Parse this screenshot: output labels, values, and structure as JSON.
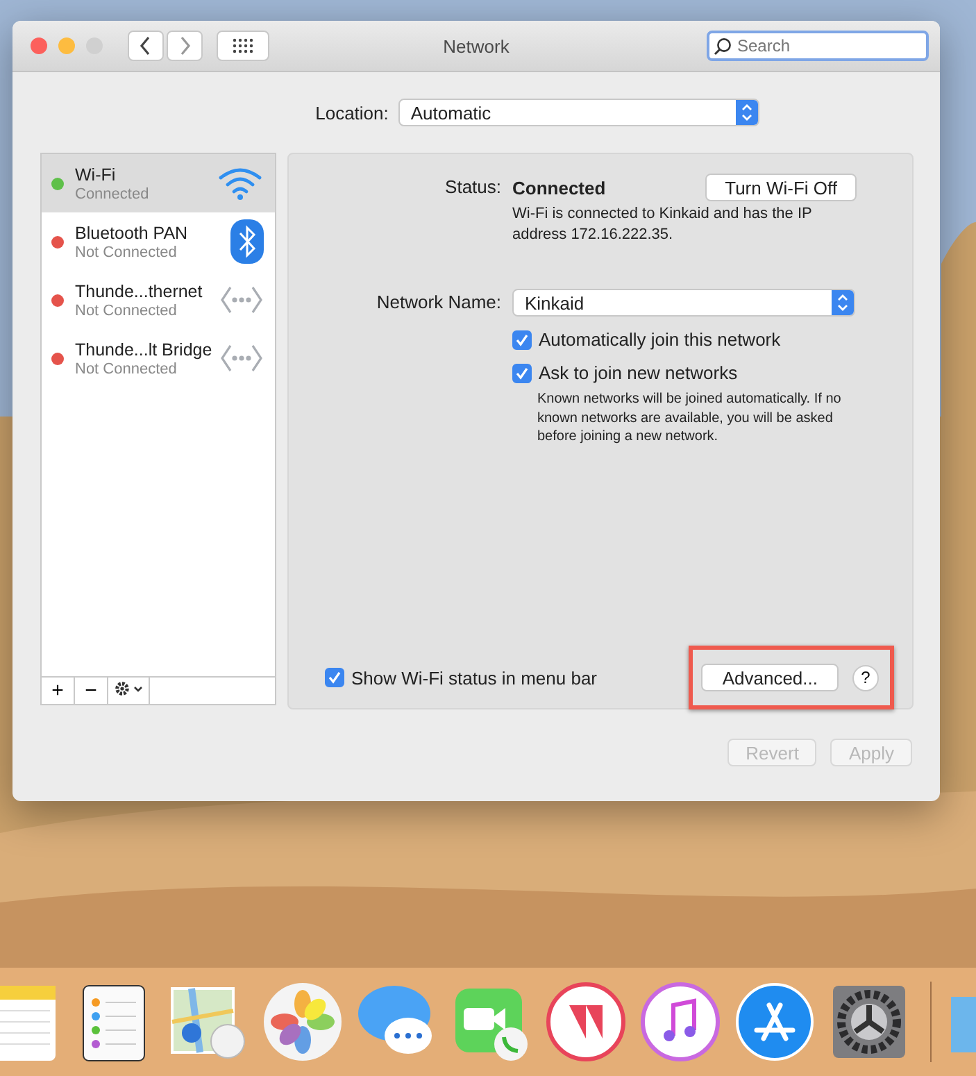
{
  "window": {
    "title": "Network"
  },
  "search": {
    "placeholder": "Search"
  },
  "location": {
    "label": "Location:",
    "value": "Automatic"
  },
  "services": [
    {
      "name": "Wi-Fi",
      "status": "Connected",
      "color": "#5fc04a",
      "selected": true,
      "kind": "wifi"
    },
    {
      "name": "Bluetooth PAN",
      "status": "Not Connected",
      "color": "#e5534b",
      "selected": false,
      "kind": "bluetooth"
    },
    {
      "name": "Thunde...thernet",
      "status": "Not Connected",
      "color": "#e5534b",
      "selected": false,
      "kind": "ethernet"
    },
    {
      "name": "Thunde...lt Bridge",
      "status": "Not Connected",
      "color": "#e5534b",
      "selected": false,
      "kind": "ethernet"
    }
  ],
  "sidebar_buttons": [
    "+",
    "−"
  ],
  "detail": {
    "status_label": "Status:",
    "status_value": "Connected",
    "turn_off_button": "Turn Wi-Fi Off",
    "status_description": "Wi-Fi is connected to Kinkaid and has the IP address 172.16.222.35.",
    "network_name_label": "Network Name:",
    "network_name_value": "Kinkaid",
    "options": [
      {
        "label": "Automatically join this network",
        "checked": true
      },
      {
        "label": "Ask to join new networks",
        "checked": true,
        "note": "Known networks will be joined automatically. If no known networks are available, you will be asked before joining a new network."
      }
    ],
    "show_status": {
      "label": "Show Wi-Fi status in menu bar",
      "checked": true
    },
    "advanced_button": {
      "label": "Advanced...",
      "highlighted": true
    },
    "help_button": "?"
  },
  "footer_buttons": [
    {
      "label": "Revert",
      "disabled": true
    },
    {
      "label": "Apply",
      "disabled": true
    }
  ]
}
